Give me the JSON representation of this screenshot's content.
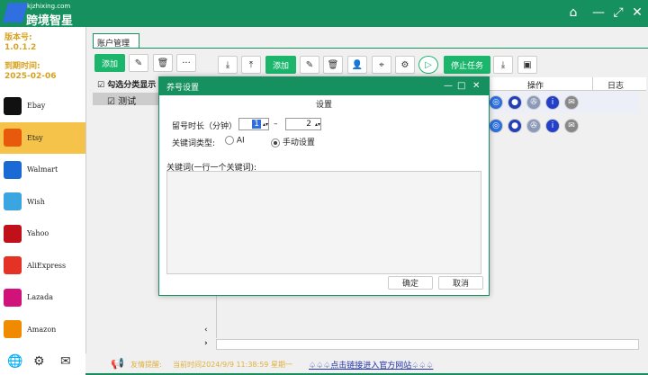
{
  "app": {
    "site": "kjzhixing.com",
    "name": "跨境智星",
    "window_buttons": [
      "home",
      "minimize",
      "maximize",
      "close"
    ]
  },
  "sidebar": {
    "version_label": "版本号:",
    "version": "1.0.1.2",
    "expiry_label": "到期时间:",
    "expiry": "2025-02-06",
    "items": [
      {
        "label": "Ebay",
        "color": "#111"
      },
      {
        "label": "Etsy",
        "color": "#e8590c",
        "active": true
      },
      {
        "label": "Walmart",
        "color": "#1a6ad6"
      },
      {
        "label": "Wish",
        "color": "#3aa5e0"
      },
      {
        "label": "Yahoo",
        "color": "#c0101a"
      },
      {
        "label": "AliExpress",
        "color": "#e43225"
      },
      {
        "label": "Lazada",
        "color": "#d1127a"
      },
      {
        "label": "Amazon",
        "color": "#f08a00"
      }
    ],
    "footer_icons": [
      "globe-icon",
      "gear-icon",
      "mail-icon"
    ]
  },
  "tabs": [
    {
      "label": "账户管理"
    }
  ],
  "toolbar_left": {
    "add": "添加",
    "more": "···"
  },
  "toolbar_right": {
    "add": "添加",
    "stop": "停止任务"
  },
  "list": {
    "select_all": "勾选分类显示",
    "group": "测试"
  },
  "table": {
    "headers": {
      "ops": "操作",
      "log": "日志"
    }
  },
  "dialog": {
    "title": "养号设置",
    "heading": "设置",
    "duration_label": "留号时长（分钟）",
    "min": "1",
    "dash": "–",
    "max": "2",
    "keyword_type_label": "关键词类型:",
    "option_ai": "AI",
    "option_manual": "手动设置",
    "selected": "manual",
    "keywords_label": "关键词(一行一个关键词):",
    "keywords": "",
    "ok": "确定",
    "cancel": "取消"
  },
  "footer": {
    "notice_label": "友情提醒:",
    "time_text": "当前时间2024/9/9  11:38:59 星期一",
    "link": "♤♤♤点击链接进入官方网站♤♤♤"
  },
  "colors": {
    "brand": "#15905e",
    "accent": "#1bb56c",
    "active_side": "#f5c24a"
  }
}
